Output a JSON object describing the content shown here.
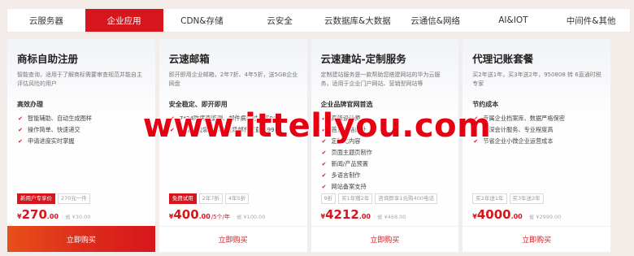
{
  "tabs": [
    {
      "label": "云服务器"
    },
    {
      "label": "企业应用"
    },
    {
      "label": "CDN&存储"
    },
    {
      "label": "云安全"
    },
    {
      "label": "云数据库&大数据"
    },
    {
      "label": "云通信&网络"
    },
    {
      "label": "AI&IOT"
    },
    {
      "label": "中间件&其他"
    }
  ],
  "active_tab": "企业应用",
  "cards": [
    {
      "title": "商标自助注册",
      "desc": "智能查询，适用于了解商标需要审查规范并能自主评估风险的用户",
      "section": "高效办理",
      "features": [
        "智能辅助、自动生成图样",
        "操作简单、快速递交",
        "申请进度实时掌握"
      ],
      "badges": [
        "新用户专享价",
        "270元一件"
      ],
      "price_cur": "¥",
      "price": "270",
      "price_decimal": ".00",
      "price_unit": "",
      "orig": "省 ¥30.00",
      "buy": "立即购买"
    },
    {
      "title": "云速邮箱",
      "desc": "即开即用企业邮箱，2年7折、4年5折，送5GB企业网盘",
      "section": "安全稳定、即开即用",
      "features": [
        "7*24防病毒监测、邮件病毒过滤率99%",
        "智能反垃圾技术、垃圾邮件拦截率99%"
      ],
      "badges": [
        "免费试用",
        "2年7折",
        "4年5折"
      ],
      "price_cur": "¥",
      "price": "400",
      "price_decimal": ".00",
      "price_unit": "/5个/年",
      "orig": "省 ¥100.00",
      "buy": "立即购买"
    },
    {
      "title": "云速建站-定制服务",
      "desc": "定制建站服务是一款帮助您搭建网站的华为云服务，适用于企业门户网站、营销型网站等",
      "section": "企业品牌官网首选",
      "features": [
        "高级设计师",
        "首页风格设计",
        "定制化内容",
        "页面主题页制作",
        "新闻/产品预置",
        "多语言制作",
        "网站备案支持"
      ],
      "badges": [
        "9折",
        "买1年赠2年",
        "咨询即享1元购400电话"
      ],
      "price_cur": "¥",
      "price": "4212",
      "price_decimal": ".00",
      "price_unit": "",
      "orig": "省 ¥468.00",
      "buy": "立即购买"
    },
    {
      "title": "代理记账套餐",
      "desc": "买2年送1年，买3年送2年，950808 转 6直通时税专家",
      "section": "节约成本",
      "features": [
        "专属企业档案库、数据严格保密",
        "资深会计服务、专业程度高",
        "节省企业小微企业运营成本"
      ],
      "badges": [
        "买2年送1年",
        "买3年送2年"
      ],
      "price_cur": "¥",
      "price": "4000",
      "price_decimal": ".00",
      "price_unit": "",
      "orig": "省 ¥2999.00",
      "buy": "立即购买"
    }
  ],
  "watermark": "www.ittellyou.com",
  "colors": {
    "accent": "#d6161c",
    "background": "#f3ece9"
  }
}
